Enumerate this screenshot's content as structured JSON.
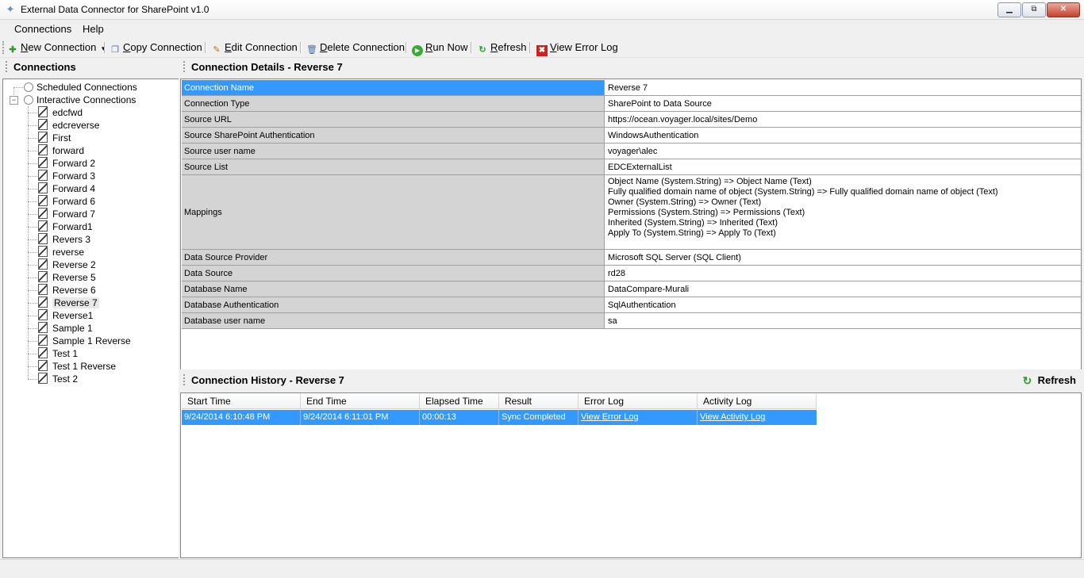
{
  "window": {
    "title": "External Data Connector for SharePoint v1.0",
    "min_glyph": "▁",
    "max_glyph": "⧉",
    "close_glyph": "✕"
  },
  "menu": {
    "items": [
      "Connections",
      "Help"
    ]
  },
  "toolbar": {
    "new_connection": {
      "first": "N",
      "rest": "ew Connection"
    },
    "copy_connection": {
      "first": "C",
      "rest": "opy Connection"
    },
    "edit_connection": {
      "first": "E",
      "rest": "dit Connection"
    },
    "delete_connection": {
      "first": "D",
      "rest": "elete Connection"
    },
    "run_now": {
      "first": "R",
      "rest": "un Now"
    },
    "refresh": {
      "first": "R",
      "rest": "efresh"
    },
    "view_error_log": {
      "first": "V",
      "rest": "iew Error Log"
    },
    "dropdown_glyph": "▾",
    "icons": {
      "new": "plus-icon",
      "copy": "copy-icon",
      "edit": "pencil-icon",
      "delete": "delete-icon",
      "run": "play-icon",
      "refresh": "refresh-icon",
      "error": "error-log-icon"
    },
    "colors": {
      "new": "#2e9d2e",
      "run": "#3aa83a",
      "refresh": "#2e9d2e",
      "error": "#cc2222"
    }
  },
  "left_panel": {
    "title": "Connections",
    "tree": {
      "scheduled": "Scheduled Connections",
      "interactive": "Interactive Connections",
      "items": [
        "edcfwd",
        "edcreverse",
        "First",
        "forward",
        "Forward 2",
        "Forward 3",
        "Forward 4",
        "Forward 6",
        "Forward 7",
        "Forward1",
        "Revers 3",
        "reverse",
        "Reverse 2",
        "Reverse 5",
        "Reverse 6",
        "Reverse 7",
        "Reverse1",
        "Sample 1",
        "Sample 1 Reverse",
        "Test 1",
        "Test 1 Reverse",
        "Test 2"
      ],
      "selected": "Reverse 7",
      "collapse_glyph": "−"
    }
  },
  "details": {
    "title": "Connection Details - Reverse 7",
    "selected_row": 0,
    "rows": [
      {
        "label": "Connection Name",
        "value": "Reverse 7"
      },
      {
        "label": "Connection Type",
        "value": "SharePoint to Data Source"
      },
      {
        "label": "Source URL",
        "value": "https://ocean.voyager.local/sites/Demo"
      },
      {
        "label": "Source SharePoint Authentication",
        "value": "WindowsAuthentication"
      },
      {
        "label": "Source user name",
        "value": "voyager\\alec"
      },
      {
        "label": "Source List",
        "value": "EDCExternalList"
      },
      {
        "label": "Mappings",
        "lines": [
          "Object Name (System.String) => Object Name (Text)",
          "Fully qualified domain name of object (System.String) => Fully qualified domain name of object (Text)",
          "Owner (System.String) => Owner (Text)",
          "Permissions (System.String) => Permissions (Text)",
          "Inherited (System.String) => Inherited (Text)",
          "Apply To (System.String) => Apply To (Text)"
        ]
      },
      {
        "label": "Data Source Provider",
        "value": "Microsoft SQL Server (SQL Client)"
      },
      {
        "label": "Data Source",
        "value": "rd28"
      },
      {
        "label": "Database Name",
        "value": "DataCompare-Murali"
      },
      {
        "label": "Database Authentication",
        "value": "SqlAuthentication"
      },
      {
        "label": "Database user name",
        "value": "sa"
      }
    ]
  },
  "history": {
    "title": "Connection History - Reverse 7",
    "refresh_label": "Refresh",
    "refresh_glyph": "↻",
    "columns": [
      "Start Time",
      "End Time",
      "Elapsed Time",
      "Result",
      "Error Log",
      "Activity Log"
    ],
    "rows": [
      {
        "start": "9/24/2014 6:10:48 PM",
        "end": "9/24/2014 6:11:01 PM",
        "elapsed": "00:00:13",
        "result": "Sync Completed",
        "error_log": "View Error Log",
        "activity_log": "View Activity Log"
      }
    ]
  }
}
